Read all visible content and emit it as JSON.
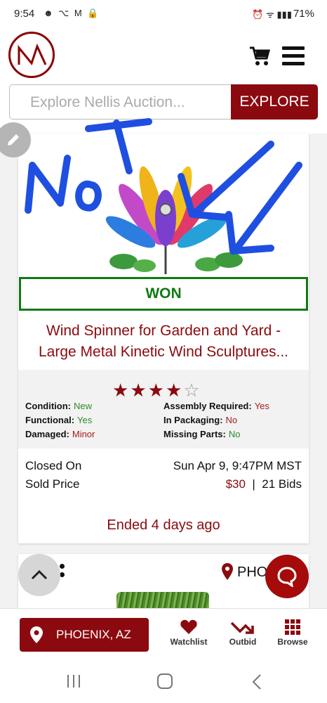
{
  "status_bar": {
    "time": "9:54",
    "left_icons": "☻ ⌥ M 🔒",
    "right_icons": "⏰ ᯤ ▮▮▮",
    "battery": "71%"
  },
  "header": {
    "search": {
      "placeholder": "Explore Nellis Auction..."
    },
    "explore_label": "EXPLORE"
  },
  "listing": {
    "won_label": "WON",
    "title_line1": "Wind Spinner for Garden and Yard -",
    "title_line2": "Large Metal Kinetic Wind Sculptures...",
    "rating": 4,
    "rating_max": 5,
    "details": {
      "condition_label": "Condition:",
      "condition_value": "New",
      "assembly_label": "Assembly Required:",
      "assembly_value": "Yes",
      "functional_label": "Functional:",
      "functional_value": "Yes",
      "packaging_label": "In Packaging:",
      "packaging_value": "No",
      "damaged_label": "Damaged:",
      "damaged_value": "Minor",
      "missing_label": "Missing Parts:",
      "missing_value": "No"
    },
    "closed_label": "Closed On",
    "closed_value": "Sun Apr 9, 9:47PM MST",
    "sold_label": "Sold Price",
    "sold_price": "$30",
    "sold_separator": "|",
    "bids": "21 Bids",
    "ended_text": "Ended 4 days ago"
  },
  "next_card": {
    "location": "PHO"
  },
  "bottom_nav": {
    "location_label": "PHOENIX, AZ",
    "watchlist_label": "Watchlist",
    "outbid_label": "Outbid",
    "browse_label": "Browse"
  },
  "colors": {
    "brand": "#8b0a0f",
    "won": "#0f7a13",
    "good": "#2a8a2a",
    "bad": "#a81b1b",
    "annotation": "#1f4fe0"
  },
  "icons": [
    "logo-icon",
    "cart-icon",
    "menu-icon",
    "edit-icon",
    "star-icon",
    "location-pin-icon",
    "chevron-up-icon",
    "chat-icon",
    "heart-icon",
    "trend-arrow-icon",
    "grid-icon",
    "recents-icon",
    "home-icon",
    "back-icon"
  ]
}
